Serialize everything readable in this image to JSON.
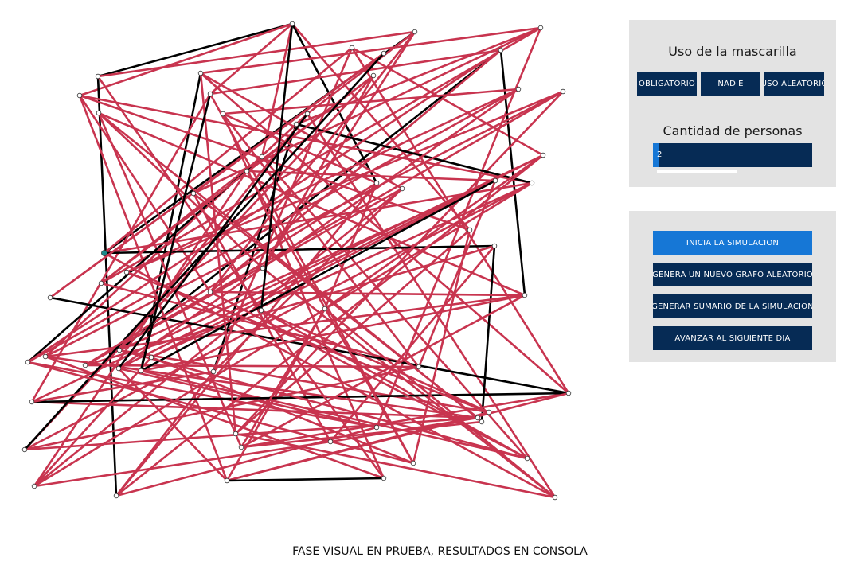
{
  "colors": {
    "panel_bg": "#e3e3e3",
    "button_bg": "#062b55",
    "button_active_bg": "#1677d6",
    "edge_red": "#c8344f",
    "edge_black": "#000000",
    "node_fill": "#ffffff",
    "highlight_node": "#1a8a8a"
  },
  "mask_panel": {
    "title": "Uso de la mascarilla",
    "buttons": [
      "OBLIGATORIO",
      "NADIE",
      "USO ALEATORIO"
    ],
    "people_title": "Cantidad de personas",
    "people_value": "2",
    "people_fraction": 0.04
  },
  "sim_panel": {
    "buttons": [
      "INICIA LA SIMULACION",
      "GENERA UN NUEVO GRAFO ALEATORIO",
      "GENERAR SUMARIO DE LA SIMULACION",
      "AVANZAR AL SIGUIENTE DIA"
    ],
    "active_index": 0
  },
  "footer": "FASE VISUAL EN PRUEBA, RESULTADOS EN CONSOLA"
}
